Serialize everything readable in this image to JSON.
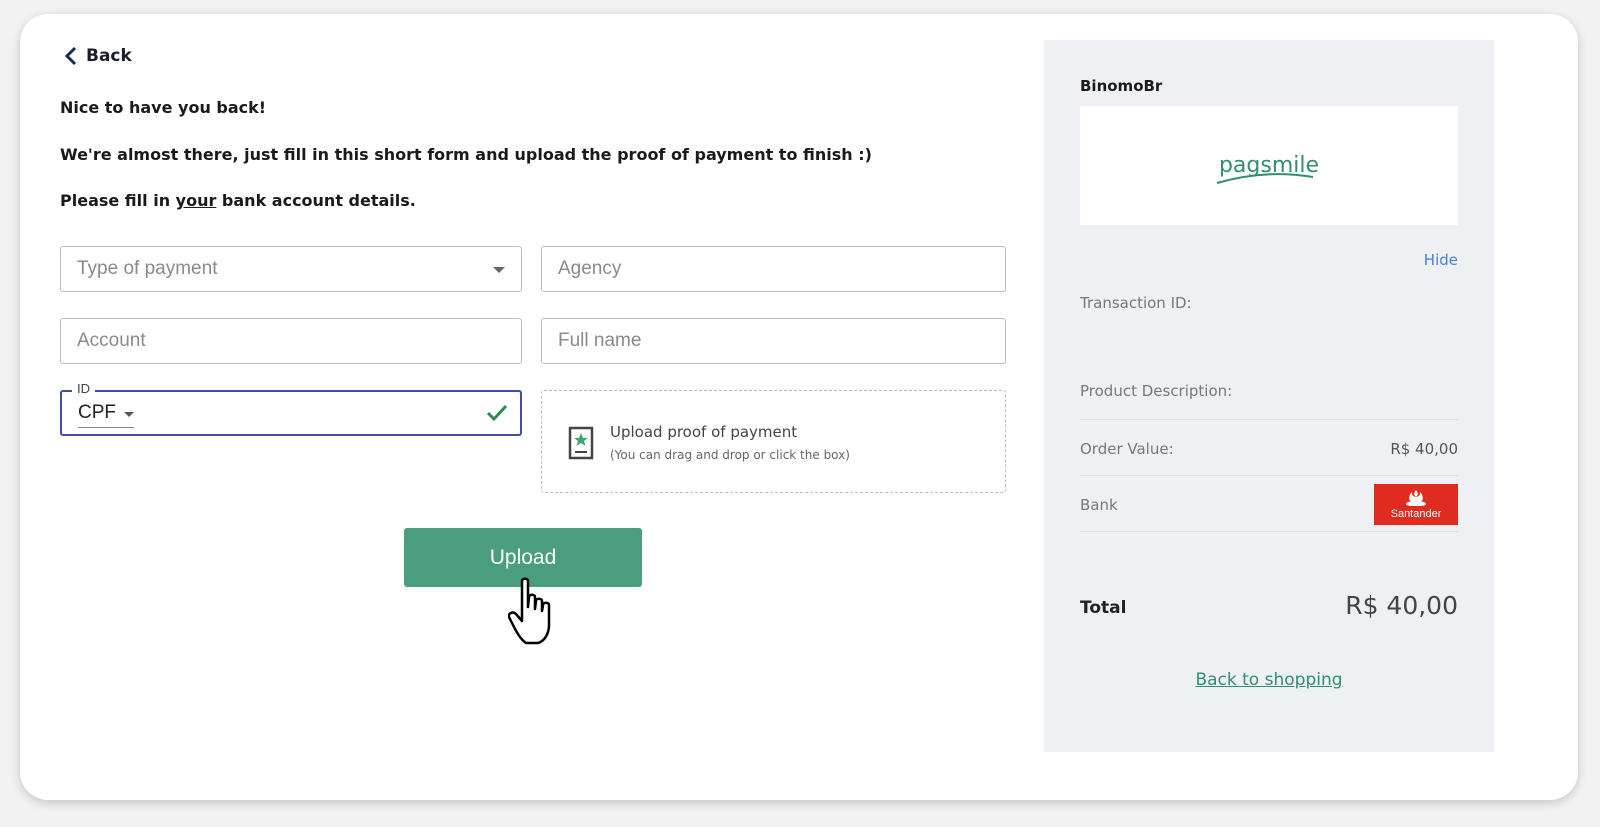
{
  "nav": {
    "back_label": "Back"
  },
  "messages": {
    "greeting": "Nice to have you back!",
    "almost": "We're almost there, just fill in this short form and upload the proof of payment to finish :)",
    "fill_prefix": "Please fill in ",
    "fill_underlined": "your",
    "fill_suffix": " bank account details."
  },
  "form": {
    "type_of_payment_placeholder": "Type of payment",
    "agency_placeholder": "Agency",
    "account_placeholder": "Account",
    "full_name_placeholder": "Full name",
    "id_label": "ID",
    "id_type_selected": "CPF",
    "upload_title": "Upload proof of payment",
    "upload_subtitle": "(You can drag and drop or click the box)",
    "upload_button": "Upload"
  },
  "summary": {
    "merchant": "BinomoBr",
    "logo_text": "pagsmile",
    "hide_label": "Hide",
    "transaction_id_label": "Transaction ID:",
    "product_description_label": "Product Description:",
    "order_value_label": "Order Value:",
    "order_value": "R$ 40,00",
    "bank_label": "Bank",
    "bank_logo_text": "Santander",
    "total_label": "Total",
    "total_value": "R$ 40,00",
    "back_to_shopping": "Back to shopping"
  },
  "colors": {
    "primary_green": "#4a9e7e",
    "focus_blue": "#3f4fa8",
    "link_blue": "#4a7de0",
    "bank_red": "#e02b20",
    "sidebar_bg": "#eef0f4"
  },
  "icons": [
    "chevron-left-icon",
    "dropdown-caret-icon",
    "checkmark-icon",
    "document-upload-icon",
    "hand-pointer-cursor-icon",
    "santander-flame-icon"
  ]
}
